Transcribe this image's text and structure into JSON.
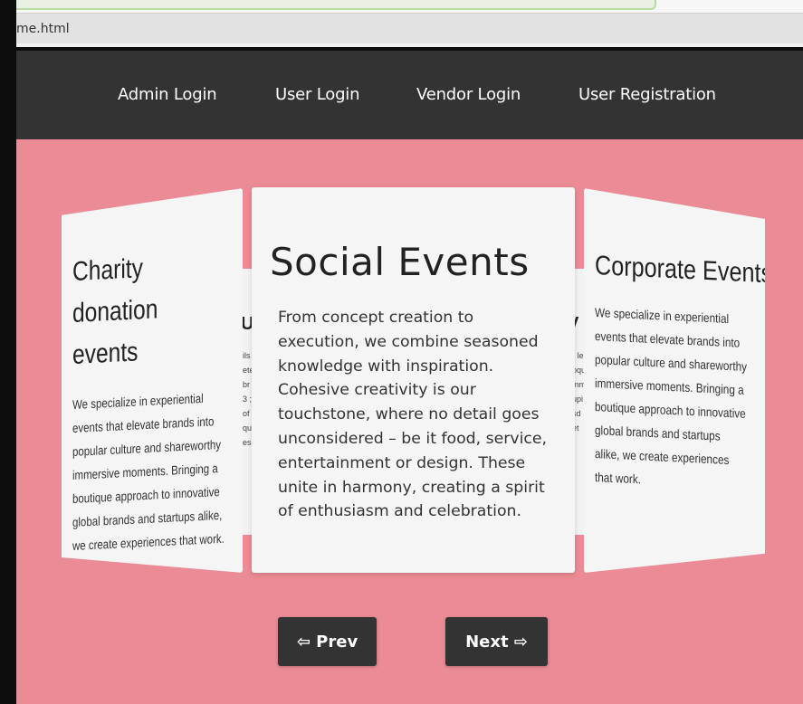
{
  "browser": {
    "url_fragment": "me.html"
  },
  "nav": {
    "items": [
      {
        "label": "Admin Login"
      },
      {
        "label": "User Login"
      },
      {
        "label": "Vendor Login"
      },
      {
        "label": "User Registration"
      }
    ]
  },
  "carousel": {
    "left_card": {
      "title": "Charity donation events",
      "body": "We specialize in experiential events that elevate brands into popular culture and shareworthy immersive moments. Bringing a boutique approach to innovative global brands and startups alike, we create experiences that work."
    },
    "center_card": {
      "title": "Social Events",
      "body": "From concept creation to execution, we combine seasoned knowledge with inspiration. Cohesive creativity is our touchstone, where no detail goes unconsidered – be it food, service, entertainment or design. These unite in harmony, creating a spirit of enthusiasm and celebration."
    },
    "right_card": {
      "title": "Corporate Events",
      "body": "We specialize in experiential events that elevate brands into popular culture and shareworthy immersive moments. Bringing a boutique approach to innovative global brands and startups alike, we create experiences that work."
    }
  },
  "controls": {
    "prev_label": "⇦ Prev",
    "next_label": "Next ⇨"
  },
  "colors": {
    "nav_bg": "#333333",
    "stage_bg": "#eb8b95",
    "card_bg": "#f6f5f6"
  }
}
